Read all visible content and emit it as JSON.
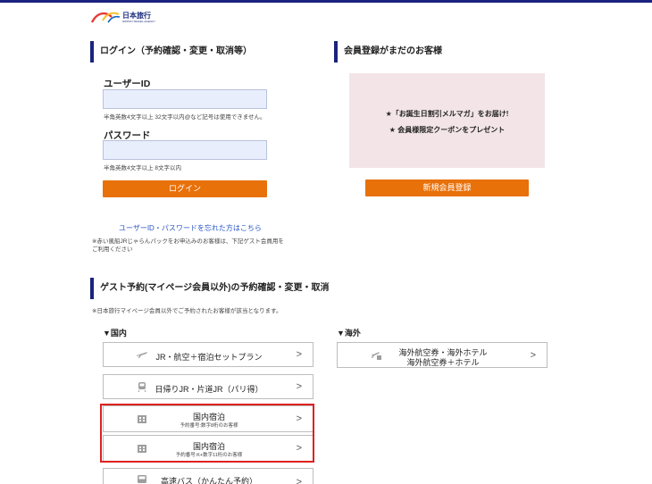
{
  "brand": {
    "name": "日本旅行",
    "sub": "NIPPON TRAVEL AGENCY"
  },
  "login": {
    "heading": "ログイン（予約確認・変更・取消等）",
    "user_id_label": "ユーザーID",
    "user_id_value": "",
    "user_id_hint": "半角英数4文字以上 32文字以内@など記号は使用できません。",
    "password_label": "パスワード",
    "password_value": "",
    "password_hint": "半角英数4文字以上 8文字以内",
    "login_button": "ログイン",
    "forgot_link": "ユーザーID・パスワードを忘れた方はこちら",
    "note": "※赤い風船JRじゃらんパックをお申込みのお客様は、下記ゲスト会員用をご利用ください"
  },
  "register": {
    "heading": "会員登録がまだのお客様",
    "promo_1": "★「お誕生日割引メルマガ」をお届け!",
    "promo_2": "★ 会員様限定クーポンをプレゼント",
    "button": "新規会員登録"
  },
  "guest": {
    "heading": "ゲスト予約(マイページ会員以外)の予約確認・変更・取消",
    "note": "※日本旅行マイページ会員以外でご予約されたお客様が該当となります。",
    "domestic_label": "▼国内",
    "overseas_label": "▼海外",
    "domestic_options": [
      {
        "title": "JR・航空＋宿泊セットプラン",
        "icon": "plane-train-icon"
      },
      {
        "title": "日帰りJR・片道JR（パリ得）",
        "icon": "train-icon"
      },
      {
        "title": "国内宿泊",
        "sub": "予約番号:数字8桁のお客様",
        "icon": "hotel-icon"
      },
      {
        "title": "国内宿泊",
        "sub": "予約番号:K+数字11桁のお客様",
        "icon": "hotel-icon"
      },
      {
        "title": "高速バス（かんたん予約）",
        "icon": "bus-icon"
      }
    ],
    "overseas_options": [
      {
        "title_1": "海外航空券・海外ホテル",
        "title_2": "海外航空券＋ホテル",
        "icon": "plane-hotel-icon"
      }
    ]
  },
  "colors": {
    "accent": "#e8710a",
    "navy": "#1a237e",
    "highlight": "#e02020",
    "promo_bg": "#f2e4e7"
  }
}
